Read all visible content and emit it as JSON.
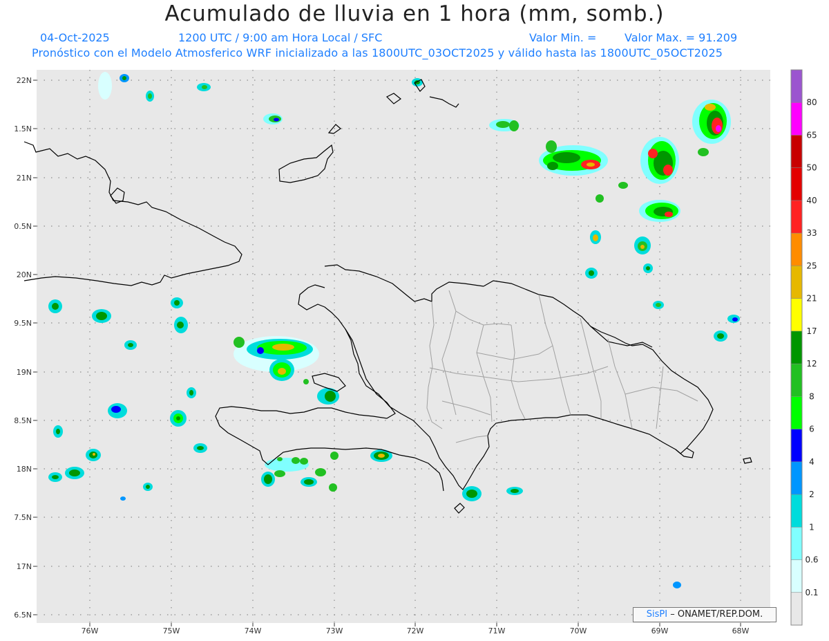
{
  "header": {
    "title": "Acumulado de lluvia en 1 hora (mm, somb.)",
    "date": "04-Oct-2025",
    "time_info": "1200 UTC / 9:00 am Hora Local / SFC",
    "valor_min": "Valor Min. =",
    "valor_max": "Valor Max. = 91.209",
    "model_info": "Pronóstico con el Modelo Atmosferico WRF inicializado a las 1800UTC_03OCT2025 y válido hasta las  1800UTC_05OCT2025"
  },
  "map": {
    "lon_labels": [
      "76W",
      "75W",
      "74W",
      "73W",
      "72W",
      "71W",
      "70W",
      "69W",
      "68W"
    ],
    "lat_labels": [
      "22N",
      "1.5N",
      "21N",
      "0.5N",
      "20N",
      "9.5N",
      "19N",
      "8.5N",
      "18N",
      "7.5N",
      "17N",
      "6.5N"
    ],
    "ocean_color": "#e8e8e8",
    "coast_color": "#000000",
    "border_color": "#a0a0a0"
  },
  "legend": {
    "labels": [
      "80",
      "65",
      "50",
      "40",
      "33",
      "25",
      "21",
      "17",
      "12",
      "8",
      "6",
      "4",
      "2",
      "1",
      "0.6",
      "0.1"
    ],
    "colors": [
      "#9b55cf",
      "#ff00ff",
      "#c80000",
      "#e30000",
      "#ff2222",
      "#ff8c00",
      "#e6b800",
      "#ffff00",
      "#009600",
      "#22c022",
      "#00ff00",
      "#0000ff",
      "#0096ff",
      "#00dcdc",
      "#80ffff",
      "#d8ffff",
      "#e8e8e8"
    ]
  },
  "credit": {
    "logo": "SisPI",
    "text": "– ONAMET/REP.DOM."
  }
}
